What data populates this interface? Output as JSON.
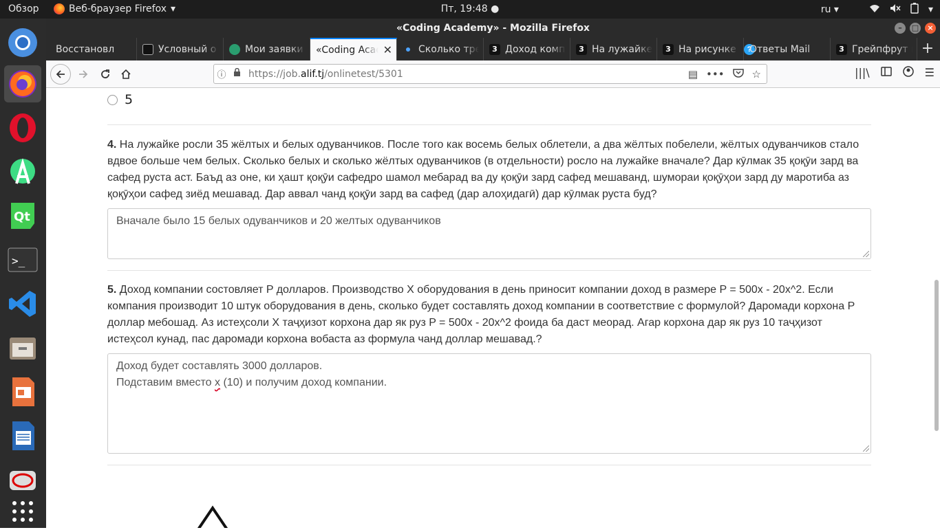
{
  "system": {
    "activities": "Обзор",
    "app_name": "Веб-браузер Firefox",
    "clock": "Пт, 19:48",
    "lang": "ru"
  },
  "window": {
    "title": "«Coding Academy» - Mozilla Firefox"
  },
  "tabs": [
    {
      "label": "Восстановл",
      "icon": "page-icon"
    },
    {
      "label": "Условный о",
      "icon": "nine-icon"
    },
    {
      "label": "Мои заявки",
      "icon": "wz-icon"
    },
    {
      "label": "«Coding Acad",
      "icon": "none",
      "selected": true
    },
    {
      "label": "Сколько тре",
      "icon": "dot-icon"
    },
    {
      "label": "Доход комп",
      "icon": "z-icon"
    },
    {
      "label": "На лужайке",
      "icon": "z-icon"
    },
    {
      "label": "На рисунке",
      "icon": "z-icon"
    },
    {
      "label": "Ответы Mail",
      "icon": "question-icon"
    },
    {
      "label": "Грейпфрут и",
      "icon": "z-icon"
    }
  ],
  "urlbar": {
    "prefix": "https://job.",
    "host": "alif.tj",
    "path": "/onlinetest/5301"
  },
  "content": {
    "prev_option": "5",
    "q4": {
      "number": "4.",
      "text": "На лужайке росли 35 жёлтых и белых одуванчиков. После того как восемь белых облетели, а два жёлтых побелели, жёлтых одуванчиков стало вдвое больше чем белых. Сколько белых и сколько жёлтых одуванчиков (в отдельности) росло на лужайке вначале? Дар кӯлмак 35 қоқӯи зард ва сафед руста аст. Баъд аз оне, ки ҳашт қоқӯи сафедро шамол мебарад ва ду қоқӯи зард сафед мешаванд, шумораи қоқӯҳои зард ду маротиба аз қоқӯҳои сафед зиёд мешавад. Дар аввал чанд қоқӯи зард ва сафед (дар алоҳидагӣ) дар кӯлмак руста буд?",
      "answer": "Вначале было 15 белых одуванчиков и 20 желтых одуванчиков"
    },
    "q5": {
      "number": "5.",
      "text": "Доход компании состовляет P долларов. Производство X оборудования в день приносит компании доход в размере P = 500x - 20x^2. Если компания производит 10 штук оборудования в день, сколько будет составлять доход компании в соответствие с формулой? Даромади корхона P доллар мебошад. Аз истеҳсоли X таҷҳизот корхона дар як руз P = 500x - 20x^2 фоида ба даст меорад. Агар корхона дар як руз 10 таҷҳизот истеҳсол кунад, пас даромади корхона вобаста аз формула чанд доллар мешавад.?",
      "answer_line1": "Доход будет составлять 3000 долларов.",
      "answer_line2_a": "Подставим вместо ",
      "answer_line2_x": "х",
      "answer_line2_b": "  (10) и получим доход компании."
    }
  }
}
